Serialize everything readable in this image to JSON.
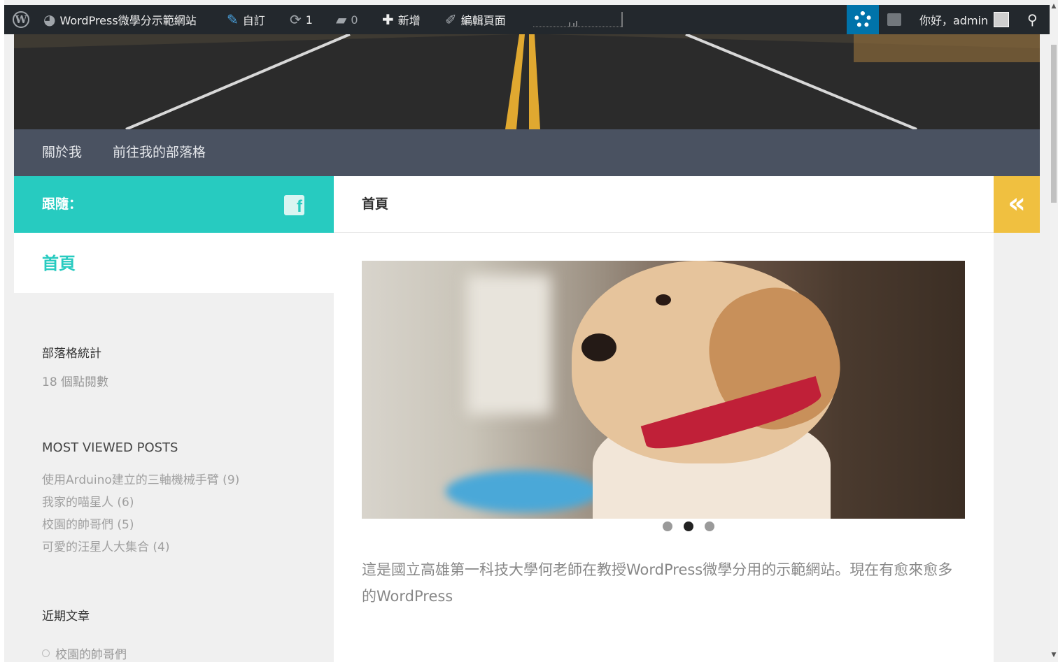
{
  "adminbar": {
    "site_name": "WordPress微學分示範網站",
    "customize": "自訂",
    "updates_count": "1",
    "comments_count": "0",
    "new_label": "新增",
    "edit_page": "編輯頁面",
    "greeting": "你好，admin",
    "icons": {
      "logo": "wordpress-logo-icon",
      "site": "dashboard-icon",
      "customize": "paintbrush-icon",
      "updates": "refresh-icon",
      "comments": "comment-icon",
      "new": "plus-icon",
      "edit": "pencil-icon",
      "support": "lifebuoy-icon",
      "notes": "notification-icon",
      "search": "search-icon"
    }
  },
  "nav": {
    "items": [
      "關於我",
      "前往我的部落格"
    ]
  },
  "follow": {
    "label": "跟隨：",
    "fb_glyph": "f"
  },
  "page_header": {
    "title": "首頁",
    "toggle_glyph": "«"
  },
  "sidebar": {
    "page_title": "首頁",
    "stats_title": "部落格統計",
    "stats_value": "18 個點閱數",
    "most_viewed_title": "MOST VIEWED POSTS",
    "most_viewed": [
      "使用Arduino建立的三軸機械手臂 (9)",
      "我家的喵星人 (6)",
      "校園的帥哥們 (5)",
      "可愛的汪星人大集合 (4)"
    ],
    "recent_title": "近期文章",
    "recent_posts": [
      "校園的帥哥們"
    ]
  },
  "content": {
    "slider": {
      "slide_count": 3,
      "active_index": 1
    },
    "excerpt": "這是國立高雄第一科技大學何老師在教授WordPress微學分用的示範網站。現在有愈來愈多的WordPress"
  },
  "colors": {
    "accent": "#27cbc0",
    "nav": "#4a5261",
    "toggle": "#f0c040",
    "adminbar": "#23282d"
  }
}
